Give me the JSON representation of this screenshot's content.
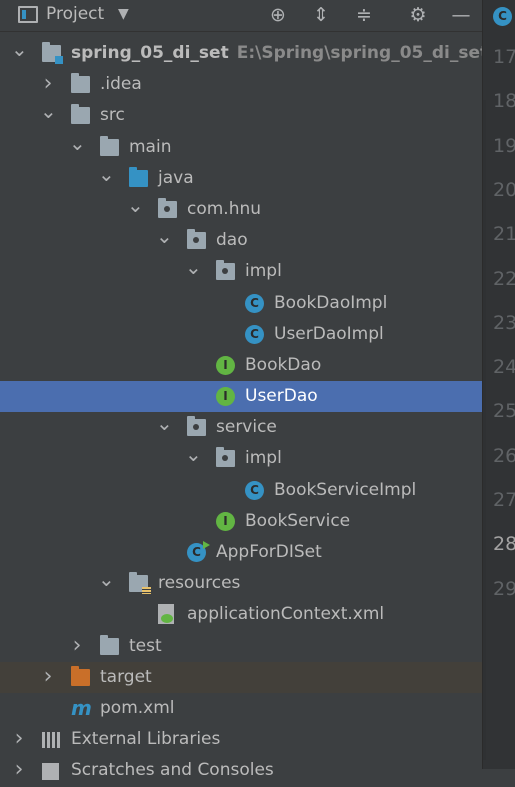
{
  "header": {
    "title": "Project"
  },
  "tree": [
    {
      "label": "spring_05_di_set",
      "path": "E:\\Spring\\spring_05_di_set",
      "depth": 0,
      "arrow": "v",
      "icon": "module-folder-icon",
      "bold": true
    },
    {
      "label": ".idea",
      "depth": 1,
      "arrow": ">",
      "icon": "folder-icon"
    },
    {
      "label": "src",
      "depth": 1,
      "arrow": "v",
      "icon": "folder-icon"
    },
    {
      "label": "main",
      "depth": 2,
      "arrow": "v",
      "icon": "folder-icon"
    },
    {
      "label": "java",
      "depth": 3,
      "arrow": "v",
      "icon": "source-folder-icon"
    },
    {
      "label": "com.hnu",
      "depth": 4,
      "arrow": "v",
      "icon": "package-icon"
    },
    {
      "label": "dao",
      "depth": 5,
      "arrow": "v",
      "icon": "package-icon"
    },
    {
      "label": "impl",
      "depth": 6,
      "arrow": "v",
      "icon": "package-icon"
    },
    {
      "label": "BookDaoImpl",
      "depth": 7,
      "arrow": "",
      "icon": "class-icon"
    },
    {
      "label": "UserDaoImpl",
      "depth": 7,
      "arrow": "",
      "icon": "class-icon"
    },
    {
      "label": "BookDao",
      "depth": 6,
      "arrow": "",
      "icon": "interface-icon"
    },
    {
      "label": "UserDao",
      "depth": 6,
      "arrow": "",
      "icon": "interface-icon",
      "selected": true
    },
    {
      "label": "service",
      "depth": 5,
      "arrow": "v",
      "icon": "package-icon"
    },
    {
      "label": "impl",
      "depth": 6,
      "arrow": "v",
      "icon": "package-icon"
    },
    {
      "label": "BookServiceImpl",
      "depth": 7,
      "arrow": "",
      "icon": "class-icon"
    },
    {
      "label": "BookService",
      "depth": 6,
      "arrow": "",
      "icon": "interface-icon"
    },
    {
      "label": "AppForDISet",
      "depth": 5,
      "arrow": "",
      "icon": "runnable-class-icon"
    },
    {
      "label": "resources",
      "depth": 3,
      "arrow": "v",
      "icon": "resources-folder-icon"
    },
    {
      "label": "applicationContext.xml",
      "depth": 4,
      "arrow": "",
      "icon": "spring-xml-icon"
    },
    {
      "label": "test",
      "depth": 2,
      "arrow": ">",
      "icon": "folder-icon"
    },
    {
      "label": "target",
      "depth": 1,
      "arrow": ">",
      "icon": "excluded-folder-icon",
      "excluded": true
    },
    {
      "label": "pom.xml",
      "depth": 1,
      "arrow": "",
      "icon": "maven-icon"
    },
    {
      "label": "External Libraries",
      "depth": 0,
      "arrow": ">",
      "icon": "libraries-icon"
    },
    {
      "label": "Scratches and Consoles",
      "depth": 0,
      "arrow": ">",
      "icon": "scratches-icon"
    }
  ],
  "gutter": {
    "lines": [
      "17",
      "18",
      "19",
      "20",
      "21",
      "22",
      "23",
      "24",
      "25",
      "26",
      "27",
      "28",
      "29"
    ],
    "active_line": "28"
  },
  "colors": {
    "selection": "#4b6eaf",
    "panel": "#3c3f41",
    "accent_blue": "#3592c4",
    "accent_green": "#62b543",
    "excluded_orange": "#c96f29"
  }
}
